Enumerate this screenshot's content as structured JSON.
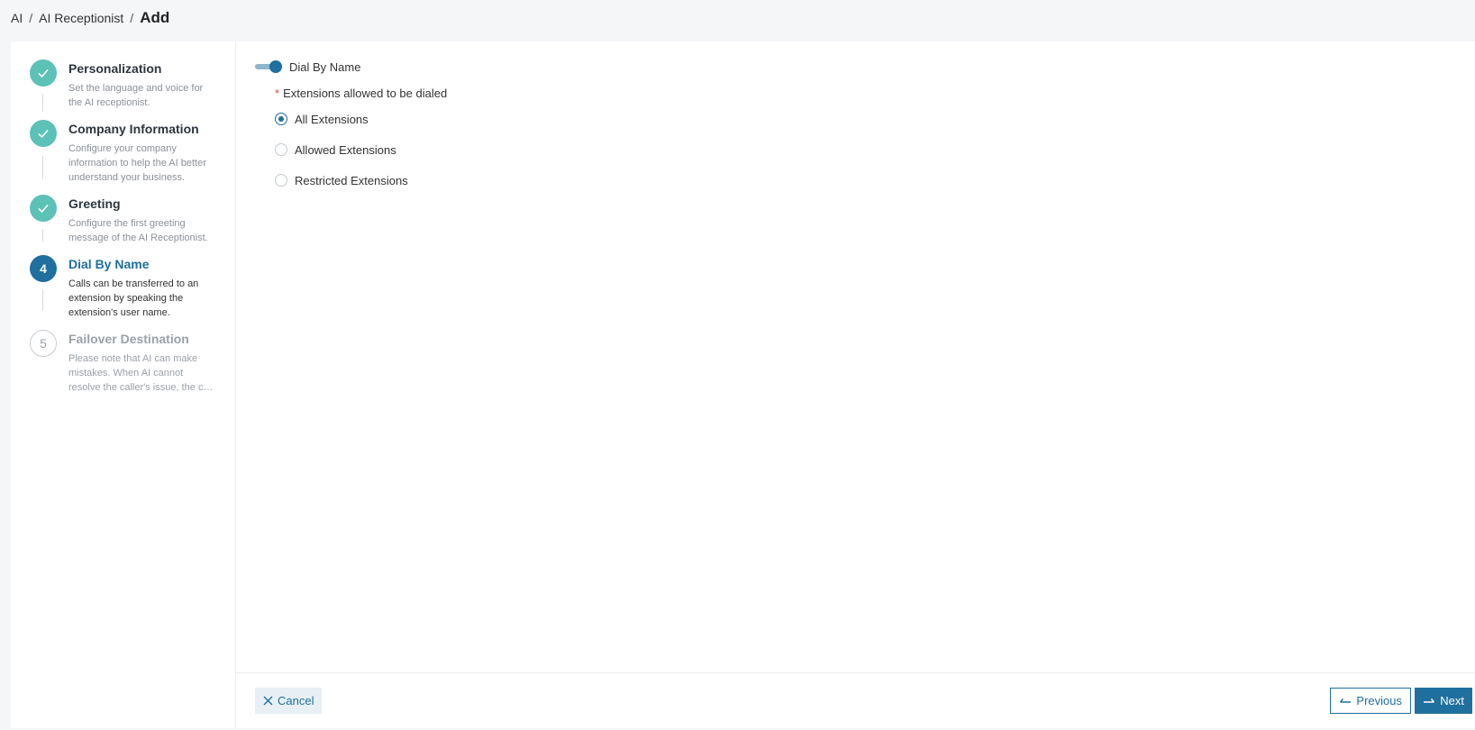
{
  "breadcrumb": {
    "items": [
      "AI",
      "AI Receptionist"
    ],
    "current": "Add"
  },
  "steps": [
    {
      "number": "1",
      "title": "Personalization",
      "desc": "Set the language and voice for the AI receptionist.",
      "state": "done"
    },
    {
      "number": "2",
      "title": "Company Information",
      "desc": "Configure your company information to help the AI better understand your business.",
      "state": "done"
    },
    {
      "number": "3",
      "title": "Greeting",
      "desc": "Configure the first greeting message of the AI Receptionist.",
      "state": "done"
    },
    {
      "number": "4",
      "title": "Dial By Name",
      "desc": "Calls can be transferred to an extension by speaking the extension's user name.",
      "state": "active"
    },
    {
      "number": "5",
      "title": "Failover Destination",
      "desc": "Please note that AI can make mistakes. When AI cannot resolve the caller's issue, the call will be…",
      "state": "pending"
    }
  ],
  "form": {
    "toggle_label": "Dial By Name",
    "toggle_on": true,
    "field_label": "Extensions allowed to be dialed",
    "required_mark": "*",
    "options": [
      "All Extensions",
      "Allowed Extensions",
      "Restricted Extensions"
    ],
    "selected": "All Extensions"
  },
  "footer": {
    "cancel_label": "Cancel",
    "previous_label": "Previous",
    "next_label": "Next"
  },
  "colors": {
    "accent": "#1f6f9f",
    "done": "#5cc1b6",
    "required": "#e54b4b"
  },
  "icons": {
    "done": "check-icon",
    "cancel": "close-icon",
    "previous": "arrow-left-icon",
    "next": "arrow-right-icon"
  }
}
